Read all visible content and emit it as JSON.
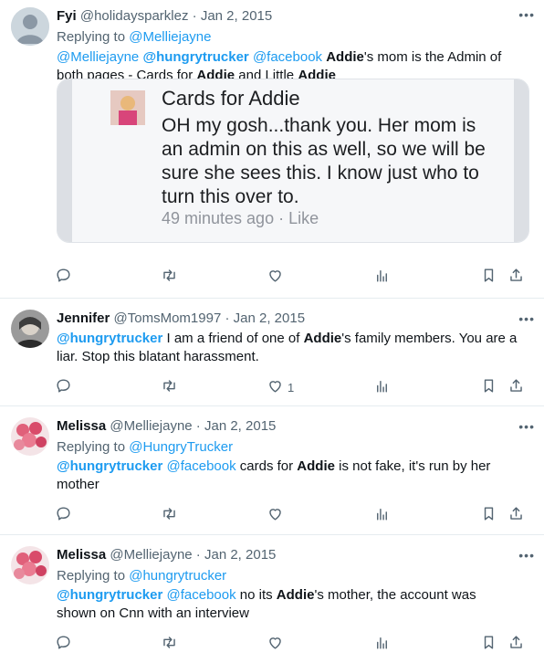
{
  "tweets": [
    {
      "name": "Fyi",
      "handle": "@holidaysparklez",
      "date": "Jan 2, 2015",
      "replying_prefix": "Replying to ",
      "replying_to": "@Melliejayne",
      "body": [
        {
          "t": "@Melliejayne",
          "k": "link"
        },
        {
          "t": " ",
          "k": "text"
        },
        {
          "t": "@hungrytrucker",
          "k": "mention"
        },
        {
          "t": " ",
          "k": "text"
        },
        {
          "t": "@facebook",
          "k": "link"
        },
        {
          "t": " ",
          "k": "text"
        },
        {
          "t": "Addie",
          "k": "bold"
        },
        {
          "t": "'s mom is the Admin of both pages - Cards for ",
          "k": "text"
        },
        {
          "t": "Addie",
          "k": "bold"
        },
        {
          "t": " and Little ",
          "k": "text"
        },
        {
          "t": "Addie",
          "k": "bold"
        }
      ],
      "embed": {
        "page_name": "Cards for Addie",
        "text": "OH my gosh...thank you. Her mom is an admin on this as well, so we will be sure she sees this.  I know just who to turn this over to.",
        "meta": "49 minutes ago · Like"
      },
      "like_count": ""
    },
    {
      "name": "Jennifer",
      "handle": "@TomsMom1997",
      "date": "Jan 2, 2015",
      "body": [
        {
          "t": "@hungrytrucker",
          "k": "mention"
        },
        {
          "t": " I am a friend of one of ",
          "k": "text"
        },
        {
          "t": "Addie",
          "k": "bold"
        },
        {
          "t": "'s family members. You are a liar. Stop this blatant harassment.",
          "k": "text"
        }
      ],
      "like_count": "1"
    },
    {
      "name": "Melissa",
      "handle": "@Melliejayne",
      "date": "Jan 2, 2015",
      "replying_prefix": "Replying to ",
      "replying_to": "@HungryTrucker",
      "body": [
        {
          "t": "@hungrytrucker",
          "k": "mention"
        },
        {
          "t": " ",
          "k": "text"
        },
        {
          "t": "@facebook",
          "k": "link"
        },
        {
          "t": " cards for ",
          "k": "text"
        },
        {
          "t": "Addie",
          "k": "bold"
        },
        {
          "t": " is not fake,  it's run by her mother",
          "k": "text"
        }
      ],
      "like_count": ""
    },
    {
      "name": "Melissa",
      "handle": "@Melliejayne",
      "date": "Jan 2, 2015",
      "replying_prefix": "Replying to ",
      "replying_to": "@hungrytrucker",
      "body": [
        {
          "t": "@hungrytrucker",
          "k": "mention"
        },
        {
          "t": " ",
          "k": "text"
        },
        {
          "t": "@facebook",
          "k": "link"
        },
        {
          "t": " no its ",
          "k": "text"
        },
        {
          "t": "Addie",
          "k": "bold"
        },
        {
          "t": "'s mother,  the account was shown on Cnn with an interview",
          "k": "text"
        }
      ],
      "like_count": ""
    }
  ],
  "separator": " · ",
  "more_label": "•••",
  "colors": {
    "link": "#1d9bf0",
    "muted": "#536471",
    "text": "#0f1419"
  },
  "icons": [
    "reply-icon",
    "retweet-icon",
    "like-icon",
    "views-icon",
    "bookmark-icon",
    "share-icon",
    "more-icon"
  ]
}
